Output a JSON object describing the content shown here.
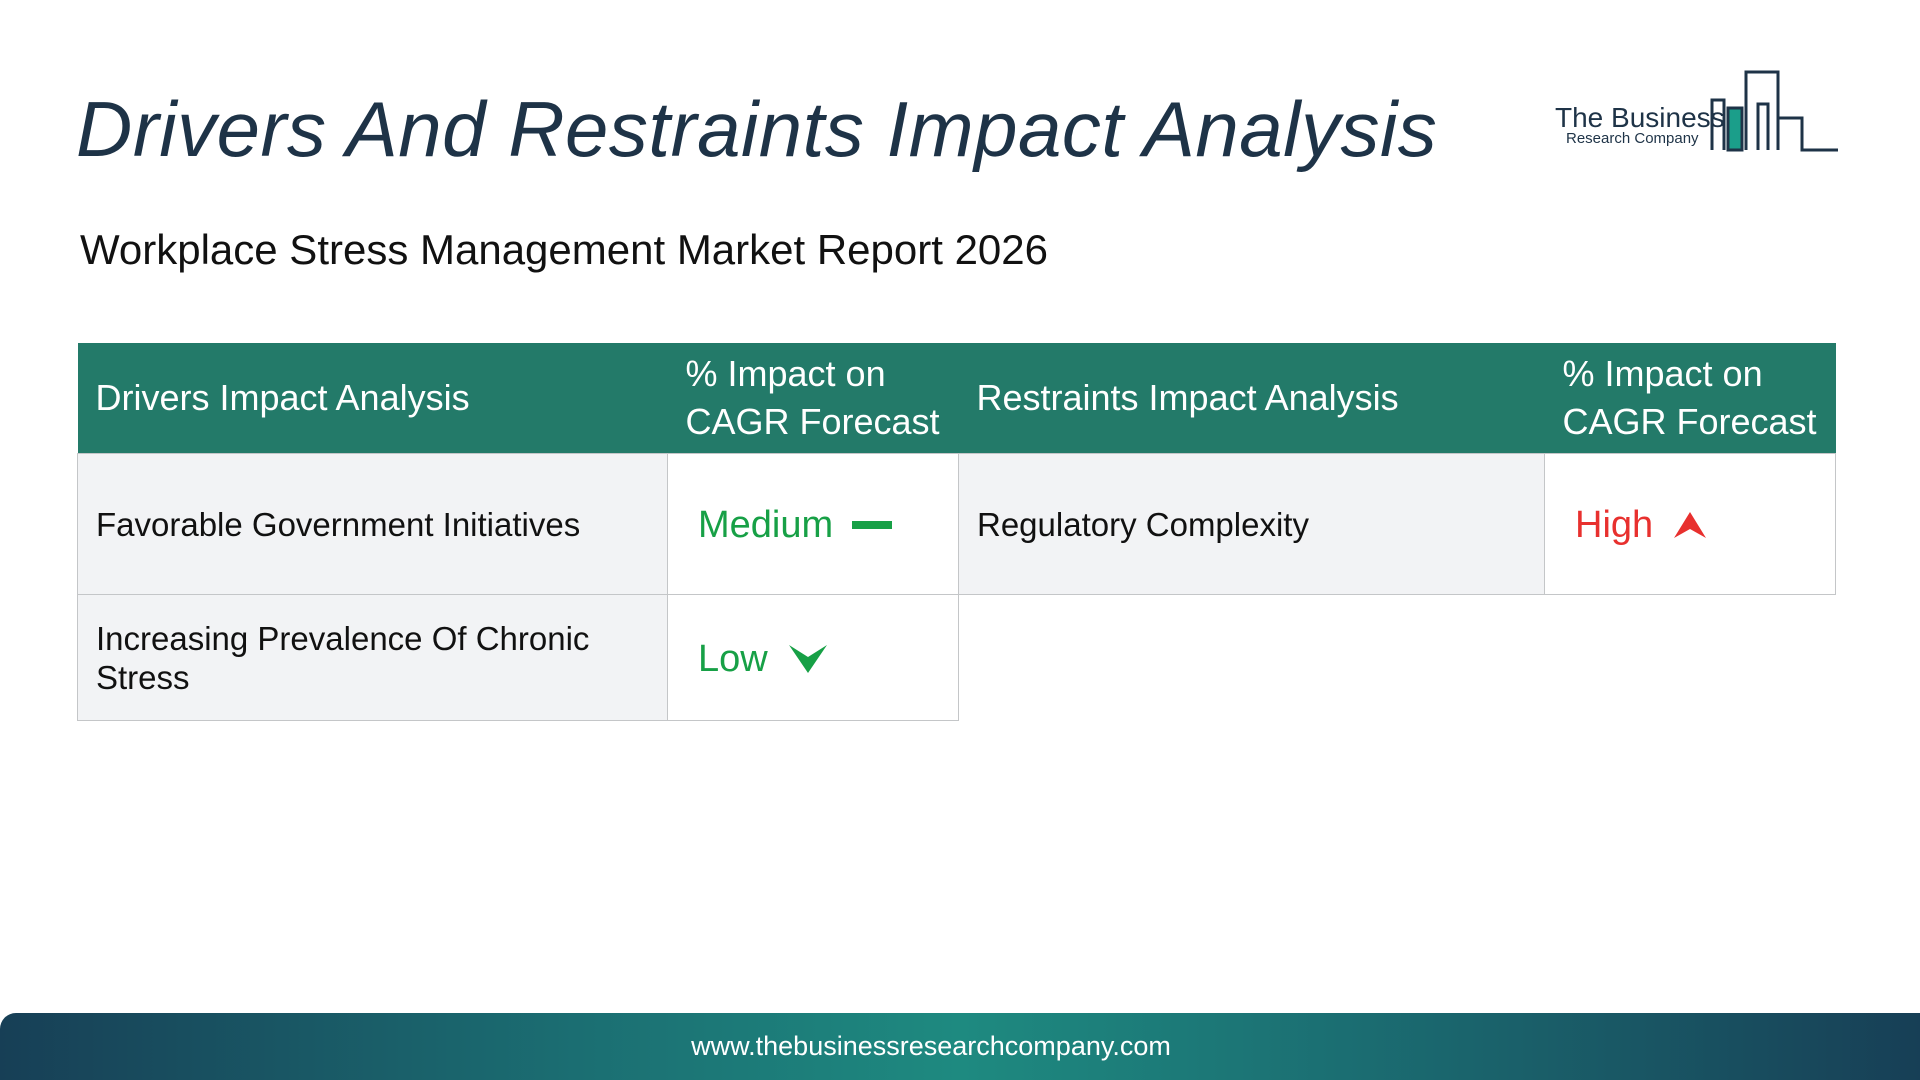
{
  "header": {
    "title": "Drivers And Restraints Impact Analysis",
    "subtitle": "Workplace Stress Management Market Report 2026"
  },
  "logo": {
    "name": "The Business",
    "tagline": "Research Company",
    "color": "#1e3347",
    "accent": "#1b9e8a"
  },
  "table": {
    "headers": {
      "drivers": "Drivers Impact Analysis",
      "drivers_impact": "% Impact on CAGR Forecast",
      "restraints": "Restraints Impact Analysis",
      "restraints_impact": "% Impact on CAGR Forecast"
    },
    "drivers": [
      {
        "name": "Favorable Government Initiatives",
        "impact": "Medium",
        "indicator": "dash-icon"
      },
      {
        "name": "Increasing Prevalence Of Chronic Stress",
        "impact": "Low",
        "indicator": "arrow-down-icon"
      }
    ],
    "restraints": [
      {
        "name": "Regulatory Complexity",
        "impact": "High",
        "indicator": "arrow-up-icon"
      }
    ]
  },
  "colors": {
    "header_bg": "#237a69",
    "impact_green": "#17a046",
    "impact_red": "#e8302e"
  },
  "footer": {
    "url": "www.thebusinessresearchcompany.com"
  }
}
